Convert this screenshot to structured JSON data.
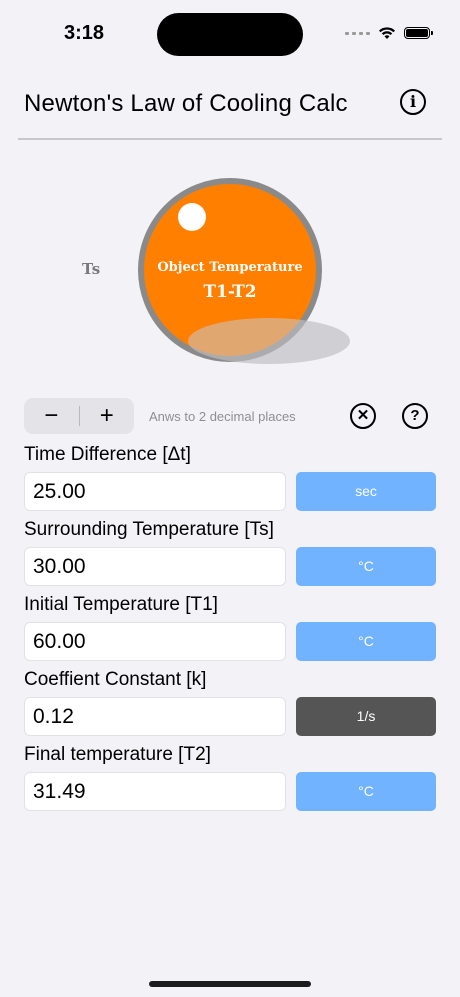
{
  "status_bar": {
    "time": "3:18"
  },
  "header": {
    "title": "Newton's Law of Cooling Calc",
    "info_glyph": "i"
  },
  "illustration": {
    "ts_label": "Ts",
    "object_label": "Object Temperature",
    "difference_label": "T1-T2",
    "object_color": "#ff7f00"
  },
  "controls": {
    "minus_label": "−",
    "plus_label": "+",
    "hint": "Anws to 2 decimal places",
    "clear_glyph": "✕",
    "help_glyph": "?"
  },
  "fields": [
    {
      "label": "Time Difference [Δt]",
      "value": "25.00",
      "unit": "sec"
    },
    {
      "label": "Surrounding Temperature [Ts]",
      "value": "30.00",
      "unit": "°C"
    },
    {
      "label": "Initial Temperature [T1]",
      "value": "60.00",
      "unit": "°C"
    },
    {
      "label": "Coeffient Constant [k]",
      "value": "0.12",
      "unit": "1/s"
    },
    {
      "label": "Final temperature [T2]",
      "value": "31.49",
      "unit": "°C"
    }
  ],
  "colors": {
    "unit_active": "#72b3ff",
    "unit_dark": "#555555",
    "background": "#f2f2f7"
  }
}
